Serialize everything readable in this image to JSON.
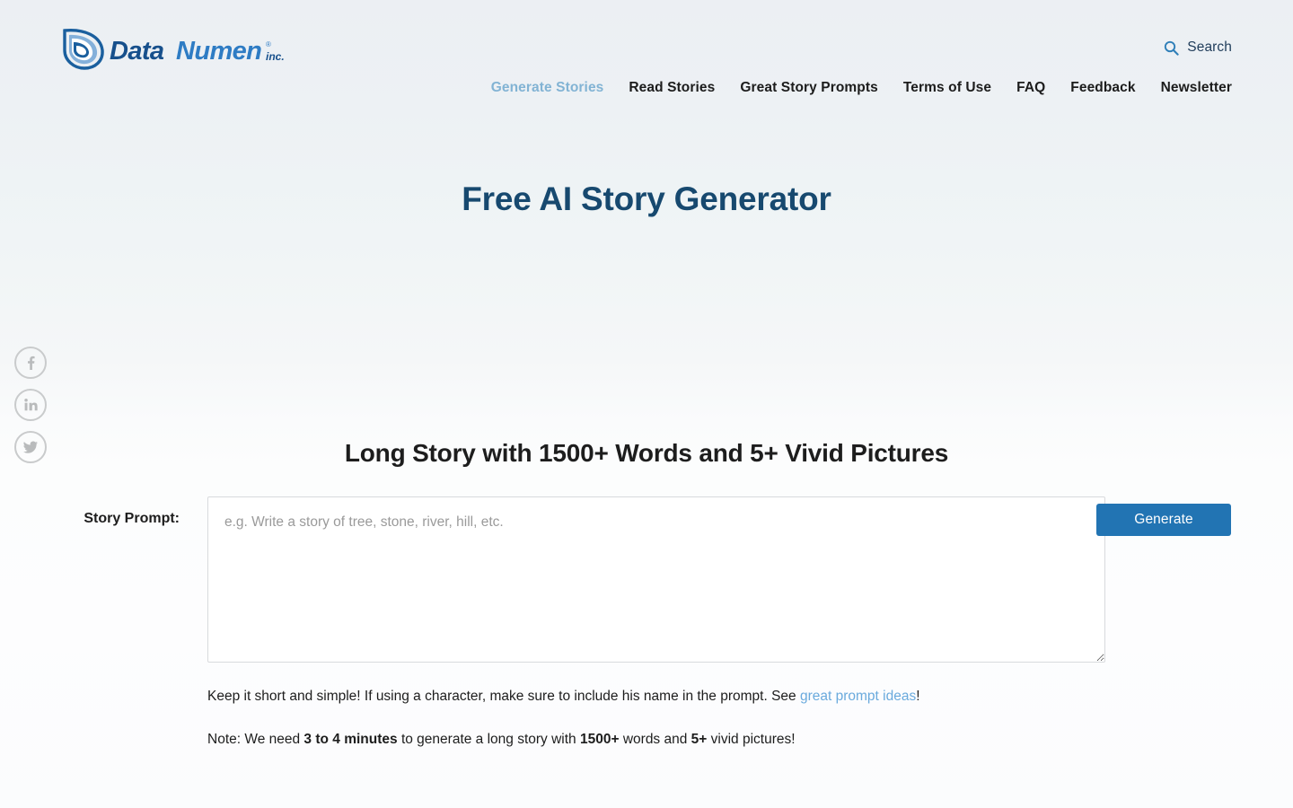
{
  "header": {
    "logo": {
      "name": "DataNumen Inc. logo",
      "text_main": "DataNumen",
      "text_suffix": "inc.",
      "mark_color": "#1a5f9e",
      "text_color": "#17508c"
    },
    "search": {
      "label": "Search",
      "icon": "search-icon",
      "color": "#1f3c5a"
    },
    "nav": [
      {
        "label": "Generate Stories",
        "active": true
      },
      {
        "label": "Read Stories",
        "active": false
      },
      {
        "label": "Great Story Prompts",
        "active": false
      },
      {
        "label": "Terms of Use",
        "active": false
      },
      {
        "label": "FAQ",
        "active": false
      },
      {
        "label": "Feedback",
        "active": false
      },
      {
        "label": "Newsletter",
        "active": false
      }
    ],
    "active_color": "#82b3d4",
    "nav_color": "#1c1c1c"
  },
  "social": {
    "items": [
      {
        "icon": "facebook-icon",
        "label": "Facebook"
      },
      {
        "icon": "linkedin-icon",
        "label": "LinkedIn"
      },
      {
        "icon": "twitter-icon",
        "label": "Twitter"
      }
    ],
    "border_color": "#c9cbcc",
    "glyph_color": "#b9bbbc"
  },
  "page": {
    "title": "Free AI Story Generator",
    "title_color": "#17496f"
  },
  "generator": {
    "section_title": "Long Story with 1500+ Words and 5+ Vivid Pictures",
    "prompt_label": "Story Prompt:",
    "prompt_placeholder": "e.g. Write a story of tree, stone, river, hill, etc.",
    "prompt_value": "",
    "generate_label": "Generate",
    "generate_color": "#2274b3",
    "hint_1": {
      "before_link": "Keep it short and simple! If using a character, make sure to include his name in the prompt. See ",
      "link_text": "great prompt ideas",
      "after_link": "!",
      "link_color": "#6aaadd"
    },
    "hint_2": {
      "part_1": "Note: We need ",
      "bold_1": "3 to 4 minutes",
      "part_2": " to generate a long story with ",
      "bold_2": "1500+",
      "part_3": " words and ",
      "bold_3": "5+",
      "part_4": " vivid pictures!"
    }
  }
}
